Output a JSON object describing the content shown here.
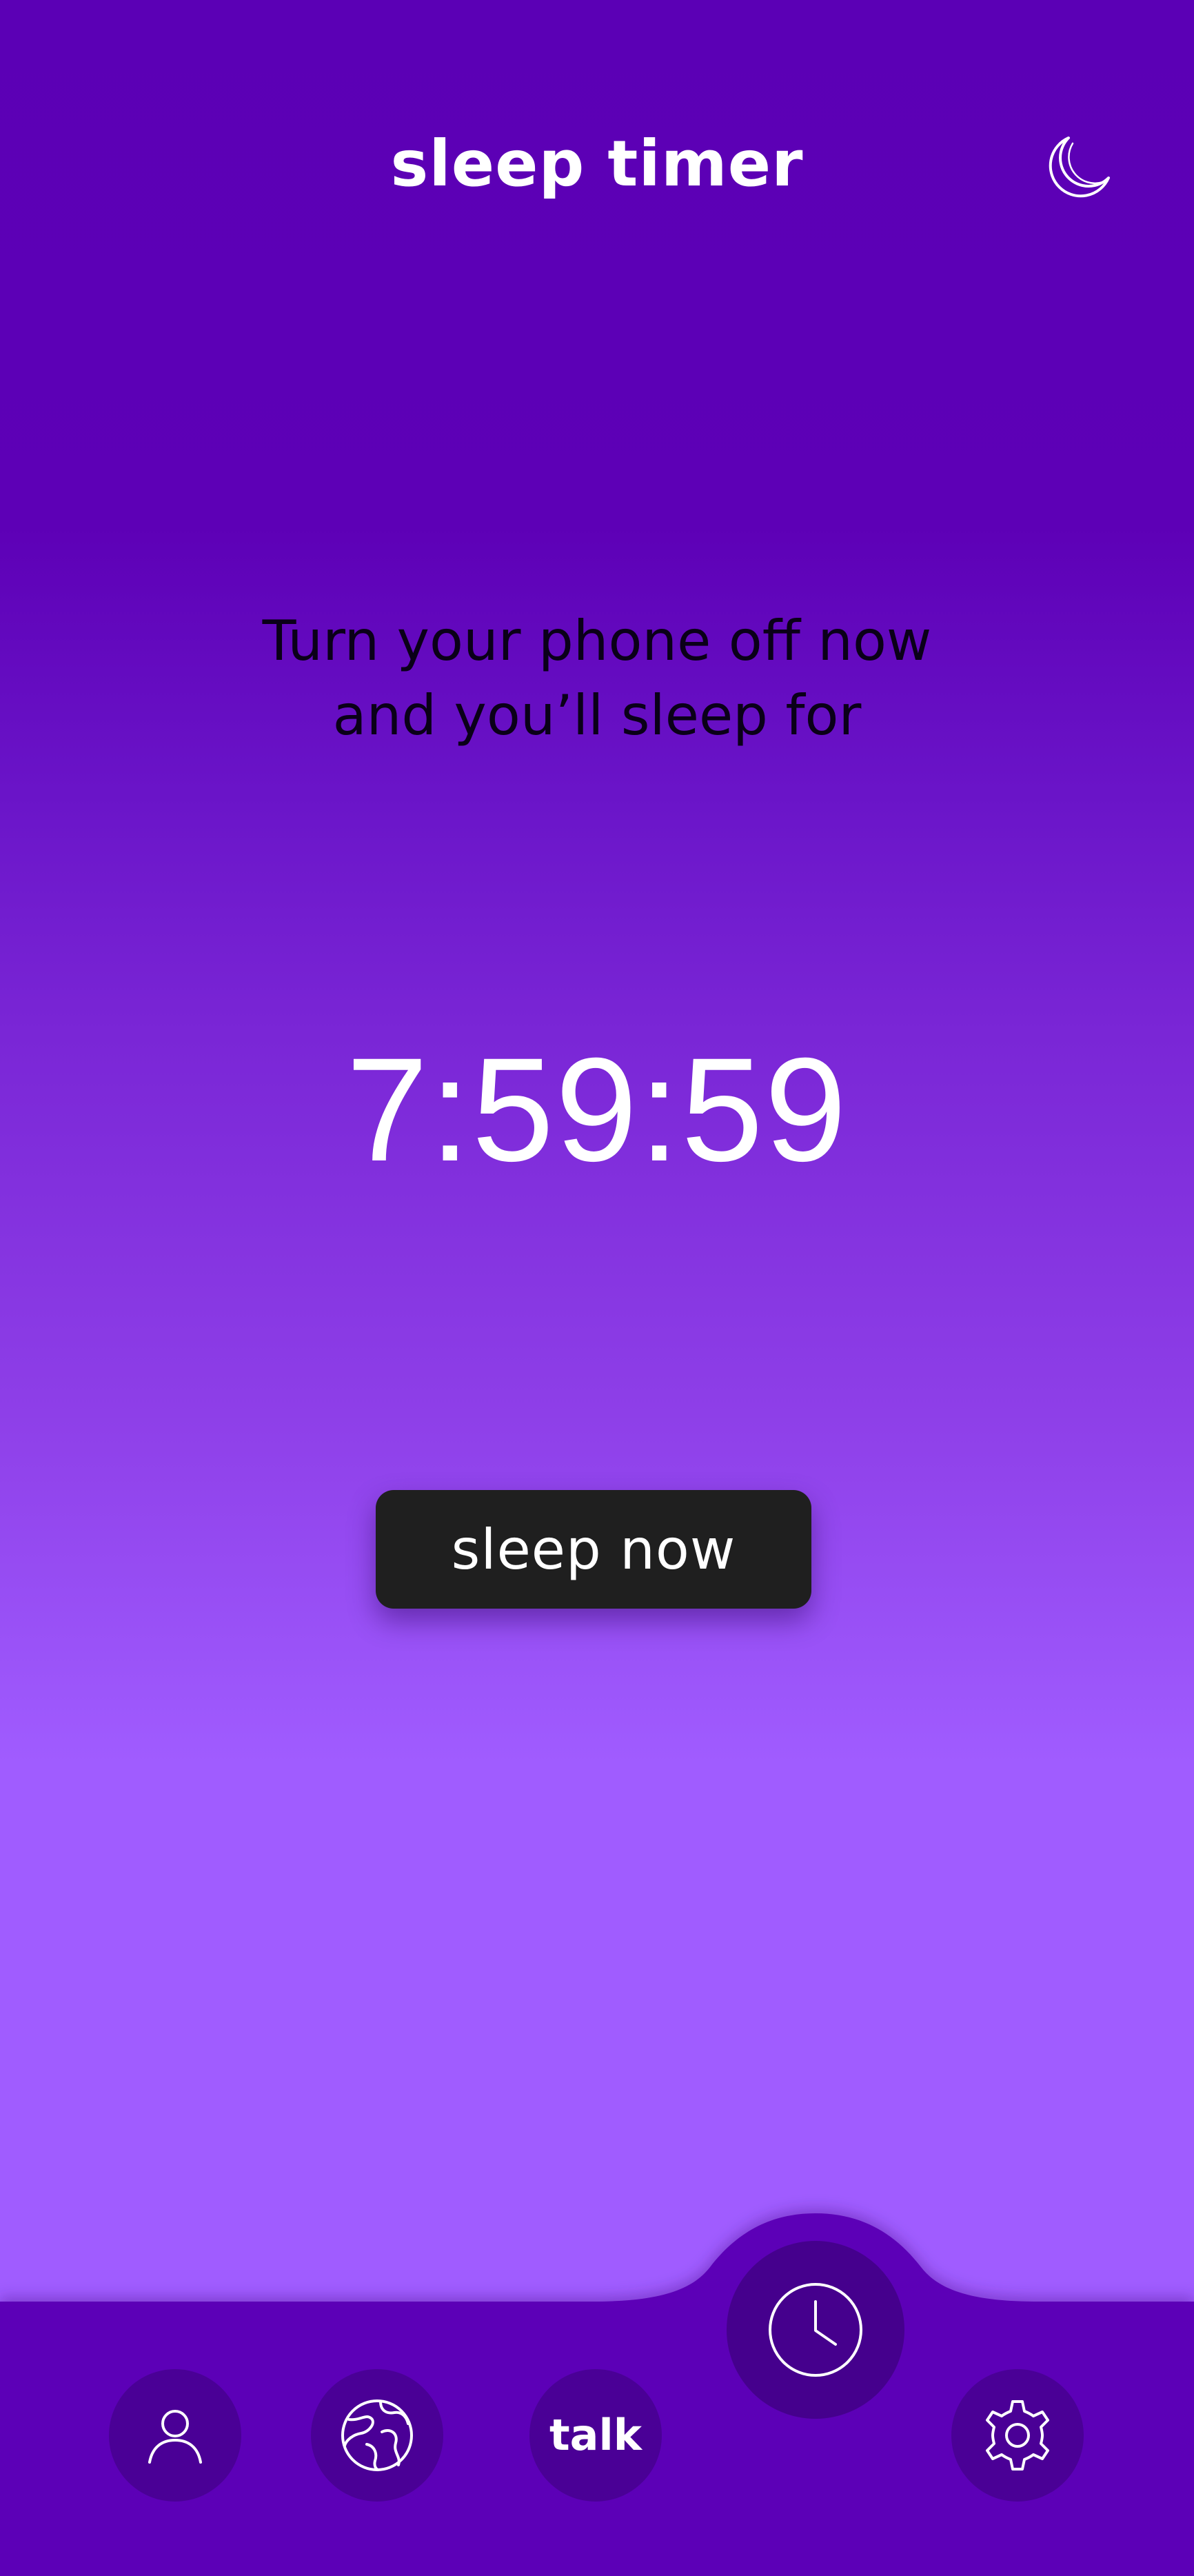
{
  "header": {
    "title": "sleep timer",
    "moon_icon": "moon-icon"
  },
  "main": {
    "subtitle_line1": "Turn your phone off now",
    "subtitle_line2": "and you’ll sleep for",
    "timer": "7:59:59",
    "sleep_button_label": "sleep now"
  },
  "tabbar": {
    "items": [
      {
        "icon": "user-icon"
      },
      {
        "icon": "globe-icon"
      },
      {
        "label": "talk"
      },
      {
        "icon": "clock-icon",
        "active": true
      },
      {
        "icon": "gear-icon"
      }
    ]
  },
  "colors": {
    "gradient_top": "#5b00b5",
    "gradient_bottom": "#a05cff",
    "tabbar_bg": "#5c00b7",
    "nav_button_bg": "#4a0096",
    "button_bg": "#1f1f1f",
    "text_light": "#ffffff",
    "text_dark": "#0a0018"
  }
}
